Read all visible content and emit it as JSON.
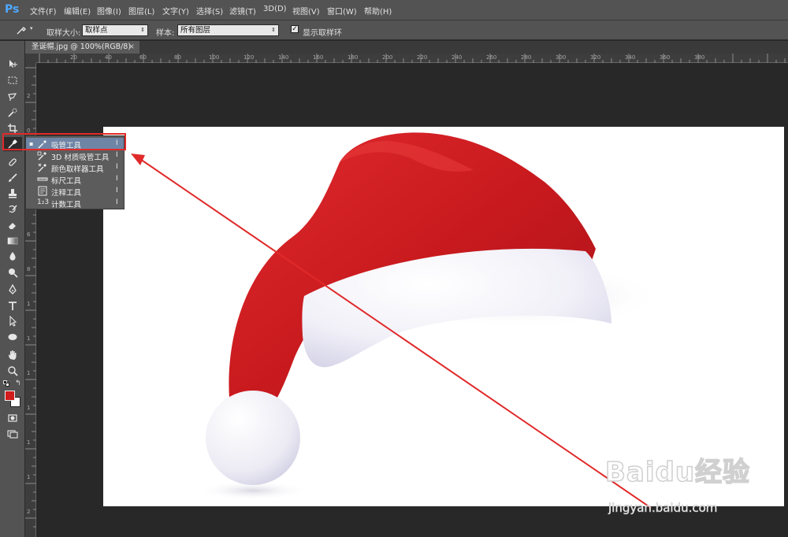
{
  "app": {
    "logo": "Ps"
  },
  "menu": [
    {
      "label": "文件(F)"
    },
    {
      "label": "编辑(E)"
    },
    {
      "label": "图像(I)"
    },
    {
      "label": "图层(L)"
    },
    {
      "label": "文字(Y)"
    },
    {
      "label": "选择(S)"
    },
    {
      "label": "滤镜(T)"
    },
    {
      "label": "3D(D)"
    },
    {
      "label": "视图(V)"
    },
    {
      "label": "窗口(W)"
    },
    {
      "label": "帮助(H)"
    }
  ],
  "options": {
    "sample_size_label": "取样大小:",
    "sample_size_value": "取样点",
    "sample_label": "样本:",
    "sample_value": "所有图层",
    "show_ring_label": "显示取样环",
    "show_ring_checked": true
  },
  "document": {
    "tab_title": "圣诞帽.jpg @ 100%(RGB/8)",
    "close_glyph": "×"
  },
  "ruler": {
    "top_ticks": [
      "20",
      "40",
      "60",
      "80",
      "100",
      "120",
      "140",
      "160",
      "180",
      "200",
      "220",
      "240",
      "260",
      "280",
      "300",
      "320",
      "340",
      "360",
      "380"
    ],
    "left_ticks": [
      "2",
      "0",
      "4",
      "6",
      "8",
      "1",
      "1",
      "1",
      "1",
      "1",
      "1",
      "1",
      "1",
      "2",
      "2"
    ]
  },
  "flyout": {
    "items": [
      {
        "label": "吸管工具",
        "key": "I",
        "icon": "eyedropper-icon",
        "active": true
      },
      {
        "label": "3D 材质吸管工具",
        "key": "I",
        "icon": "3d-eyedropper-icon",
        "active": false
      },
      {
        "label": "颜色取样器工具",
        "key": "I",
        "icon": "color-sampler-icon",
        "active": false
      },
      {
        "label": "标尺工具",
        "key": "I",
        "icon": "ruler-icon",
        "active": false
      },
      {
        "label": "注释工具",
        "key": "I",
        "icon": "note-icon",
        "active": false
      },
      {
        "label": "计数工具",
        "key": "I",
        "icon": "count-icon",
        "active": false
      }
    ],
    "bullet": "▪",
    "count_glyph": "1₂3"
  },
  "colors": {
    "foreground": "#d01c1c",
    "background": "#ffffff",
    "highlight": "#e02a2a",
    "hat_red": "#c81a1e",
    "accent_blue": "#4ea8ff"
  },
  "watermark": {
    "brand": "Baidu经验",
    "url": "jingyan.baidu.com"
  }
}
